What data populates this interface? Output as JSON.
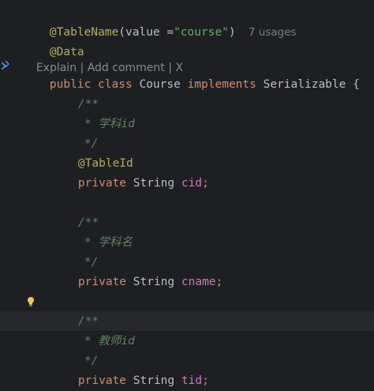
{
  "editor": {
    "line_annotation_tablename": "@TableName",
    "line_annotation_tablename_args_open": "(value =",
    "line_annotation_tablename_string": "\"course\"",
    "line_annotation_tablename_close": ")",
    "usages_hint": "7 usages",
    "line_annotation_data": "@Data",
    "codevision": {
      "explain": "Explain",
      "sep1": " | ",
      "add_comment": "Add comment",
      "sep2": " | ",
      "close": "X"
    },
    "class_decl": {
      "kw_public": "public",
      "kw_class": "class",
      "class_name": "Course",
      "kw_implements": "implements",
      "interface": "Serializable",
      "brace": "{"
    },
    "doc1": {
      "open": "/**",
      "text": "* 学科id",
      "close": "*/"
    },
    "annotation_tableid": "@TableId",
    "field_cid": {
      "kw": "private",
      "type": "String",
      "name": "cid",
      "semi": ";"
    },
    "doc2": {
      "open": "/**",
      "text": "* 学科名",
      "close": "*/"
    },
    "field_cname": {
      "kw": "private",
      "type": "String",
      "name": "cname",
      "semi": ";"
    },
    "doc3": {
      "open": "/**",
      "text": "* 教师id",
      "close": "*/"
    },
    "field_tid": {
      "kw": "private",
      "type": "String",
      "name": "tid",
      "semi": ";"
    }
  },
  "colors": {
    "background": "#1e1f22",
    "annotation": "#b3ae60",
    "keyword": "#cf8e6d",
    "string": "#6aab73",
    "field": "#c77dbb",
    "doc_comment": "#5f826b",
    "hint": "#7a7e85"
  },
  "icons": {
    "gutter_implements": "implements-gutter-icon",
    "intention_bulb": "lightbulb-icon"
  }
}
